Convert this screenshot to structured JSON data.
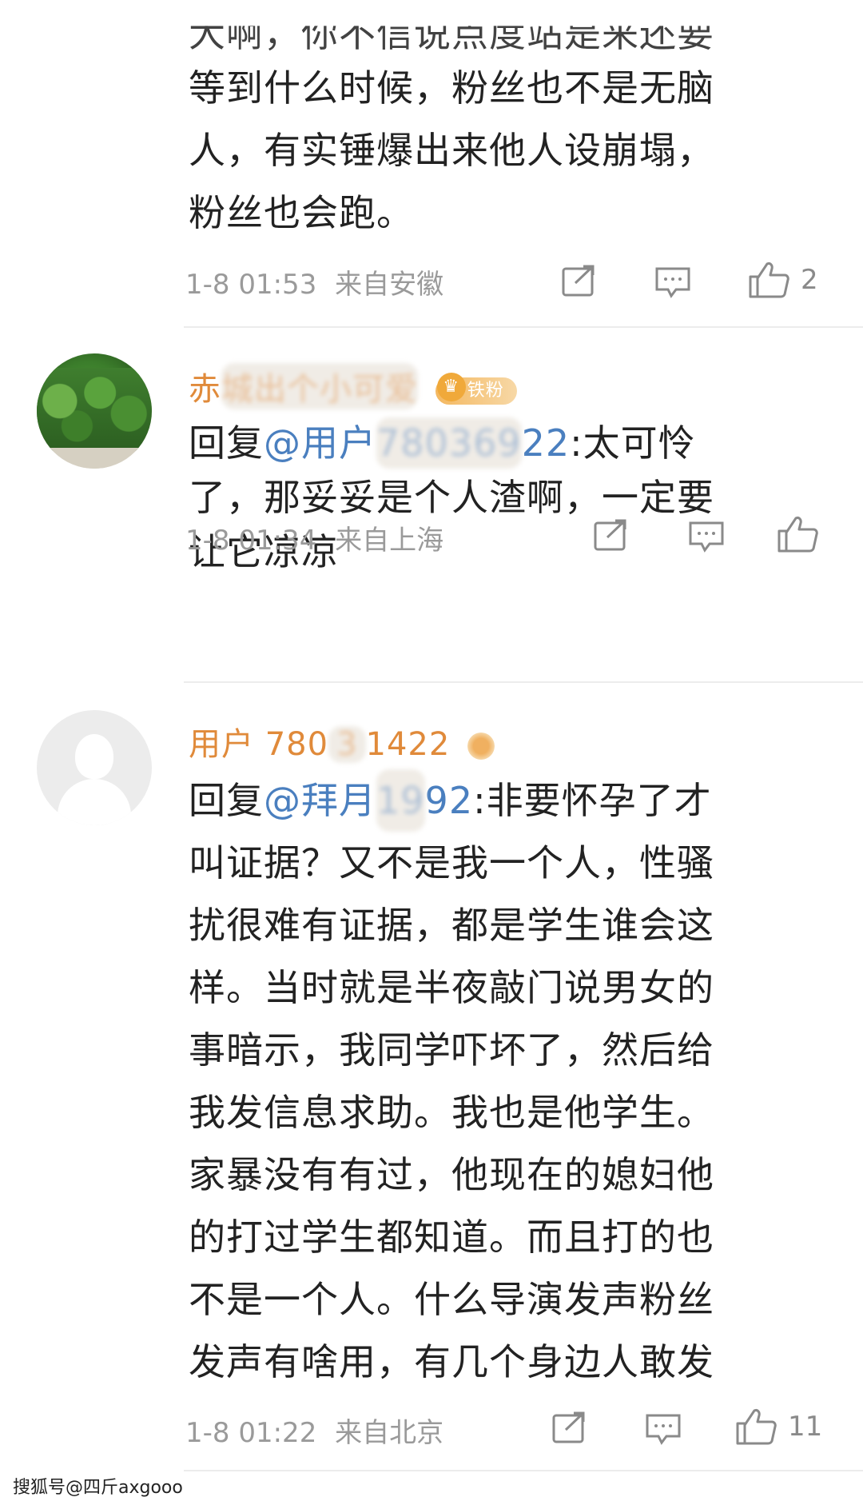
{
  "comments": [
    {
      "top_cut_text": "大啊，你不信说点度站是来还要",
      "lines": [
        "等到什么时候，粉丝也不是无脑",
        "人，有实锤爆出来他人设崩塌，",
        "粉丝也会跑。"
      ],
      "time": "1-8 01:53",
      "location": "来自安徽",
      "like_count": "2"
    },
    {
      "username_visible": "赤",
      "username_blurred": "城出个小可爱",
      "badge_label": "铁粉",
      "reply_prefix": "回复",
      "reply_mention_visible": "@用户",
      "reply_mention_blurred": "780369",
      "reply_mention_tail": "22",
      "lines": [
        ":太可怜",
        "了，那妥妥是个人渣啊，一定要",
        "让它凉凉"
      ],
      "time": "1-8 01:34",
      "location": "来自上海",
      "like_count": ""
    },
    {
      "username_visible": "用户 780",
      "username_blurred": "3",
      "username_tail": "1422",
      "reply_prefix": "回复",
      "reply_mention_visible": "@拜月",
      "reply_mention_blurred": "19",
      "reply_mention_tail": "92",
      "lines": [
        ":非要怀孕了才",
        "叫证据？又不是我一个人，性骚",
        "扰很难有证据，都是学生谁会这",
        "样。当时就是半夜敲门说男女的",
        "事暗示，我同学吓坏了，然后给",
        "我发信息求助。我也是他学生。",
        "家暴没有有过，他现在的媳妇他",
        "的打过学生都知道。而且打的也",
        "不是一个人。什么导演发声粉丝",
        "发声有啥用，有几个身边人敢发"
      ],
      "time": "1-8 01:22",
      "location": "来自北京",
      "like_count": "11"
    }
  ],
  "watermark": "搜狐号@四斤axgooo",
  "icons": [
    "share-icon",
    "comment-icon",
    "like-icon",
    "avatar-default-icon"
  ],
  "colors": {
    "username": "#e08a3a",
    "mention": "#4a7fbf",
    "text": "#222222",
    "meta": "#9a9a9a"
  }
}
